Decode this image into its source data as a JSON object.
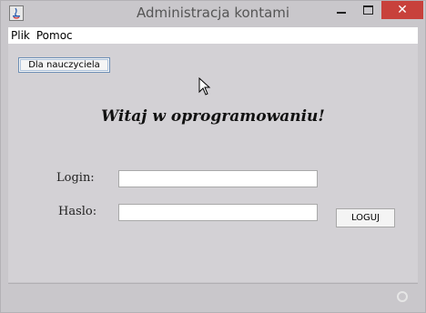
{
  "window": {
    "title": "Administracja kontami"
  },
  "menu": {
    "items": [
      {
        "label": "Plik"
      },
      {
        "label": "Pomoc"
      }
    ]
  },
  "main": {
    "teacher_button_label": "Dla nauczyciela",
    "welcome_text": "Witaj w oprogramowaniu!",
    "login_label": "Login:",
    "login_value": "",
    "password_label": "Haslo:",
    "password_value": "",
    "login_button_label": "LOGUJ"
  },
  "colors": {
    "window_bg": "#c9c7cb",
    "close_button": "#c8413b",
    "menubar_bg": "#ffffff"
  }
}
